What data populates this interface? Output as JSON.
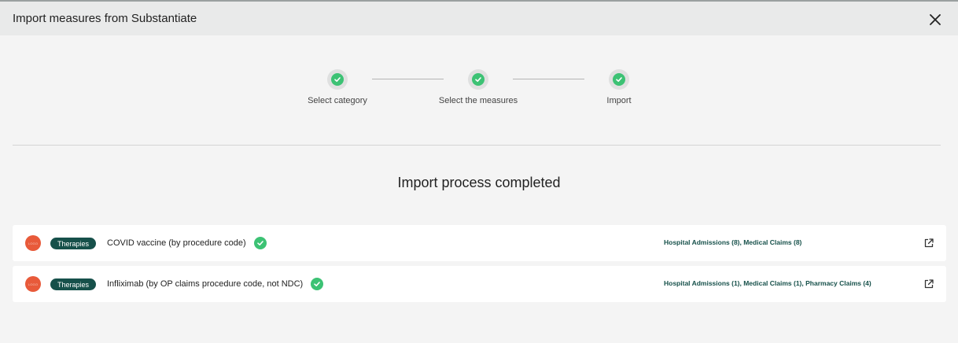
{
  "modal": {
    "title": "Import measures from Substantiate",
    "close_icon": "close-icon"
  },
  "stepper": {
    "steps": [
      {
        "label": "Select category",
        "status": "complete"
      },
      {
        "label": "Select the measures",
        "status": "complete"
      },
      {
        "label": "Import",
        "status": "complete"
      }
    ]
  },
  "result": {
    "title": "Import process completed"
  },
  "measures": [
    {
      "logo_text": "LOGO",
      "category": "Therapies",
      "name": "COVID vaccine (by procedure code)",
      "status": "imported",
      "sources": "Hospital Admissions (8), Medical Claims (8)",
      "link_icon": "external-link-icon"
    },
    {
      "logo_text": "LOGO",
      "category": "Therapies",
      "name": "Infliximab (by OP claims procedure code, not NDC)",
      "status": "imported",
      "sources": "Hospital Admissions (1), Medical Claims (1), Pharmacy Claims (4)",
      "link_icon": "external-link-icon"
    }
  ],
  "colors": {
    "accent_green": "#3cc274",
    "badge_teal": "#16504a",
    "logo_red": "#e85a3a"
  }
}
